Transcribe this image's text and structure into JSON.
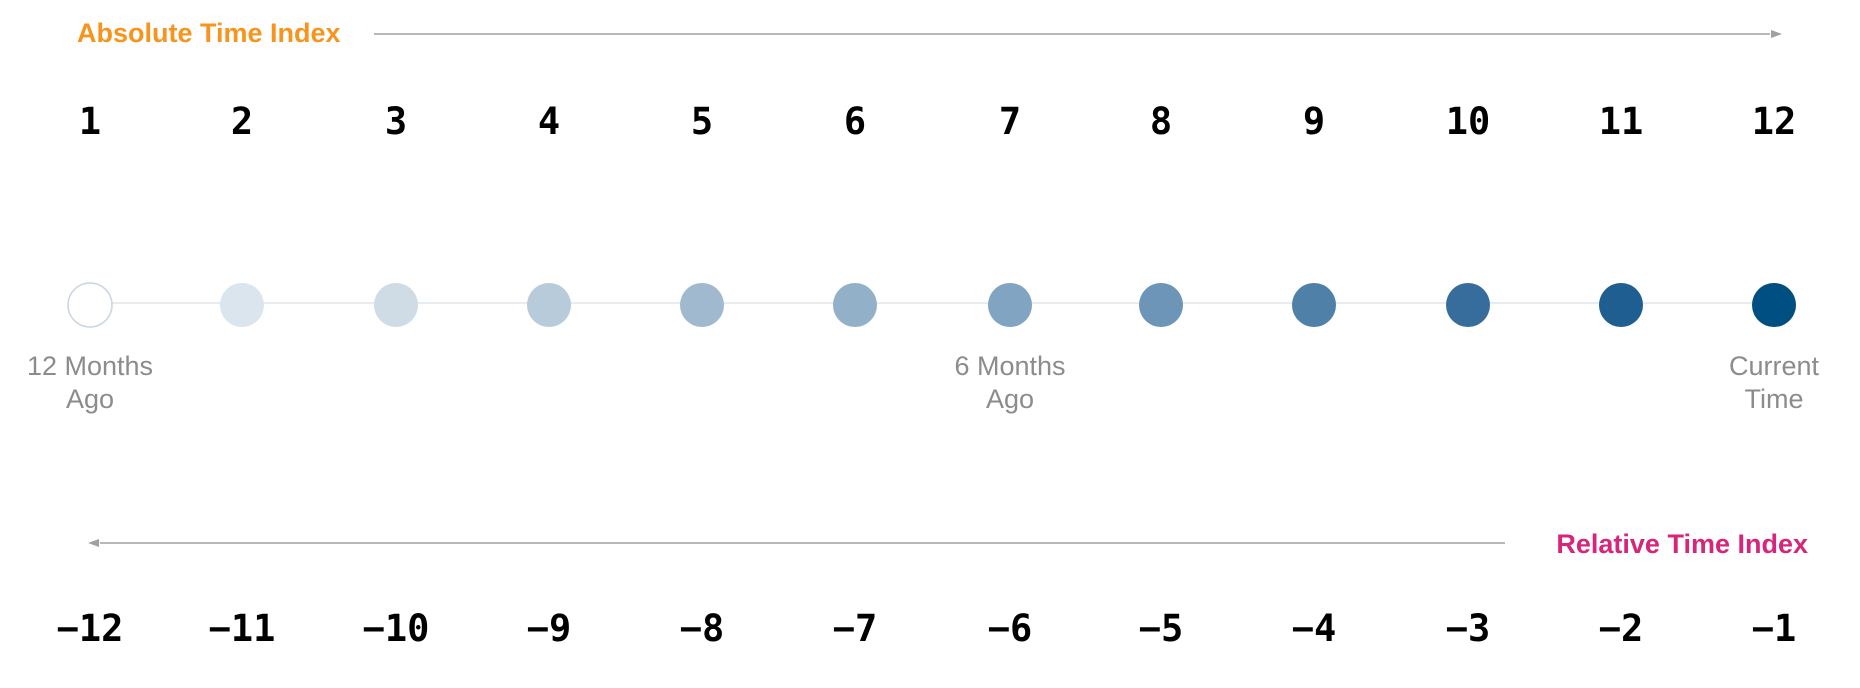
{
  "absolute_axis": {
    "title": "Absolute Time Index",
    "labels": [
      "1",
      "2",
      "3",
      "4",
      "5",
      "6",
      "7",
      "8",
      "9",
      "10",
      "11",
      "12"
    ]
  },
  "relative_axis": {
    "title": "Relative Time Index",
    "labels": [
      "−12",
      "−11",
      "−10",
      "−9",
      "−8",
      "−7",
      "−6",
      "−5",
      "−4",
      "−3",
      "−2",
      "−1"
    ]
  },
  "time_points": [
    {
      "index": 1,
      "fill": "#ffffff",
      "stroke": "#c9d6e3"
    },
    {
      "index": 2,
      "fill": "#dbe5ee",
      "stroke": "none"
    },
    {
      "index": 3,
      "fill": "#cfdbe5",
      "stroke": "none"
    },
    {
      "index": 4,
      "fill": "#b7cbda",
      "stroke": "none"
    },
    {
      "index": 5,
      "fill": "#a0b9cf",
      "stroke": "none"
    },
    {
      "index": 6,
      "fill": "#92b0c8",
      "stroke": "none"
    },
    {
      "index": 7,
      "fill": "#80a4c1",
      "stroke": "none"
    },
    {
      "index": 8,
      "fill": "#6d95b7",
      "stroke": "none"
    },
    {
      "index": 9,
      "fill": "#4f80a7",
      "stroke": "none"
    },
    {
      "index": 10,
      "fill": "#376d9c",
      "stroke": "none"
    },
    {
      "index": 11,
      "fill": "#1f5e90",
      "stroke": "none"
    },
    {
      "index": 12,
      "fill": "#004f82",
      "stroke": "none"
    }
  ],
  "markers": [
    {
      "index": 1,
      "line1": "12 Months",
      "line2": "Ago"
    },
    {
      "index": 7,
      "line1": "6 Months",
      "line2": "Ago"
    },
    {
      "index": 12,
      "line1": "Current",
      "line2": "Time"
    }
  ],
  "colors": {
    "absolute_title": "#f7941d",
    "relative_title": "#d6257a",
    "axis_arrow": "#a0a0a0",
    "timeline": "#e8ecef",
    "marker_text": "#8c8c8c"
  }
}
